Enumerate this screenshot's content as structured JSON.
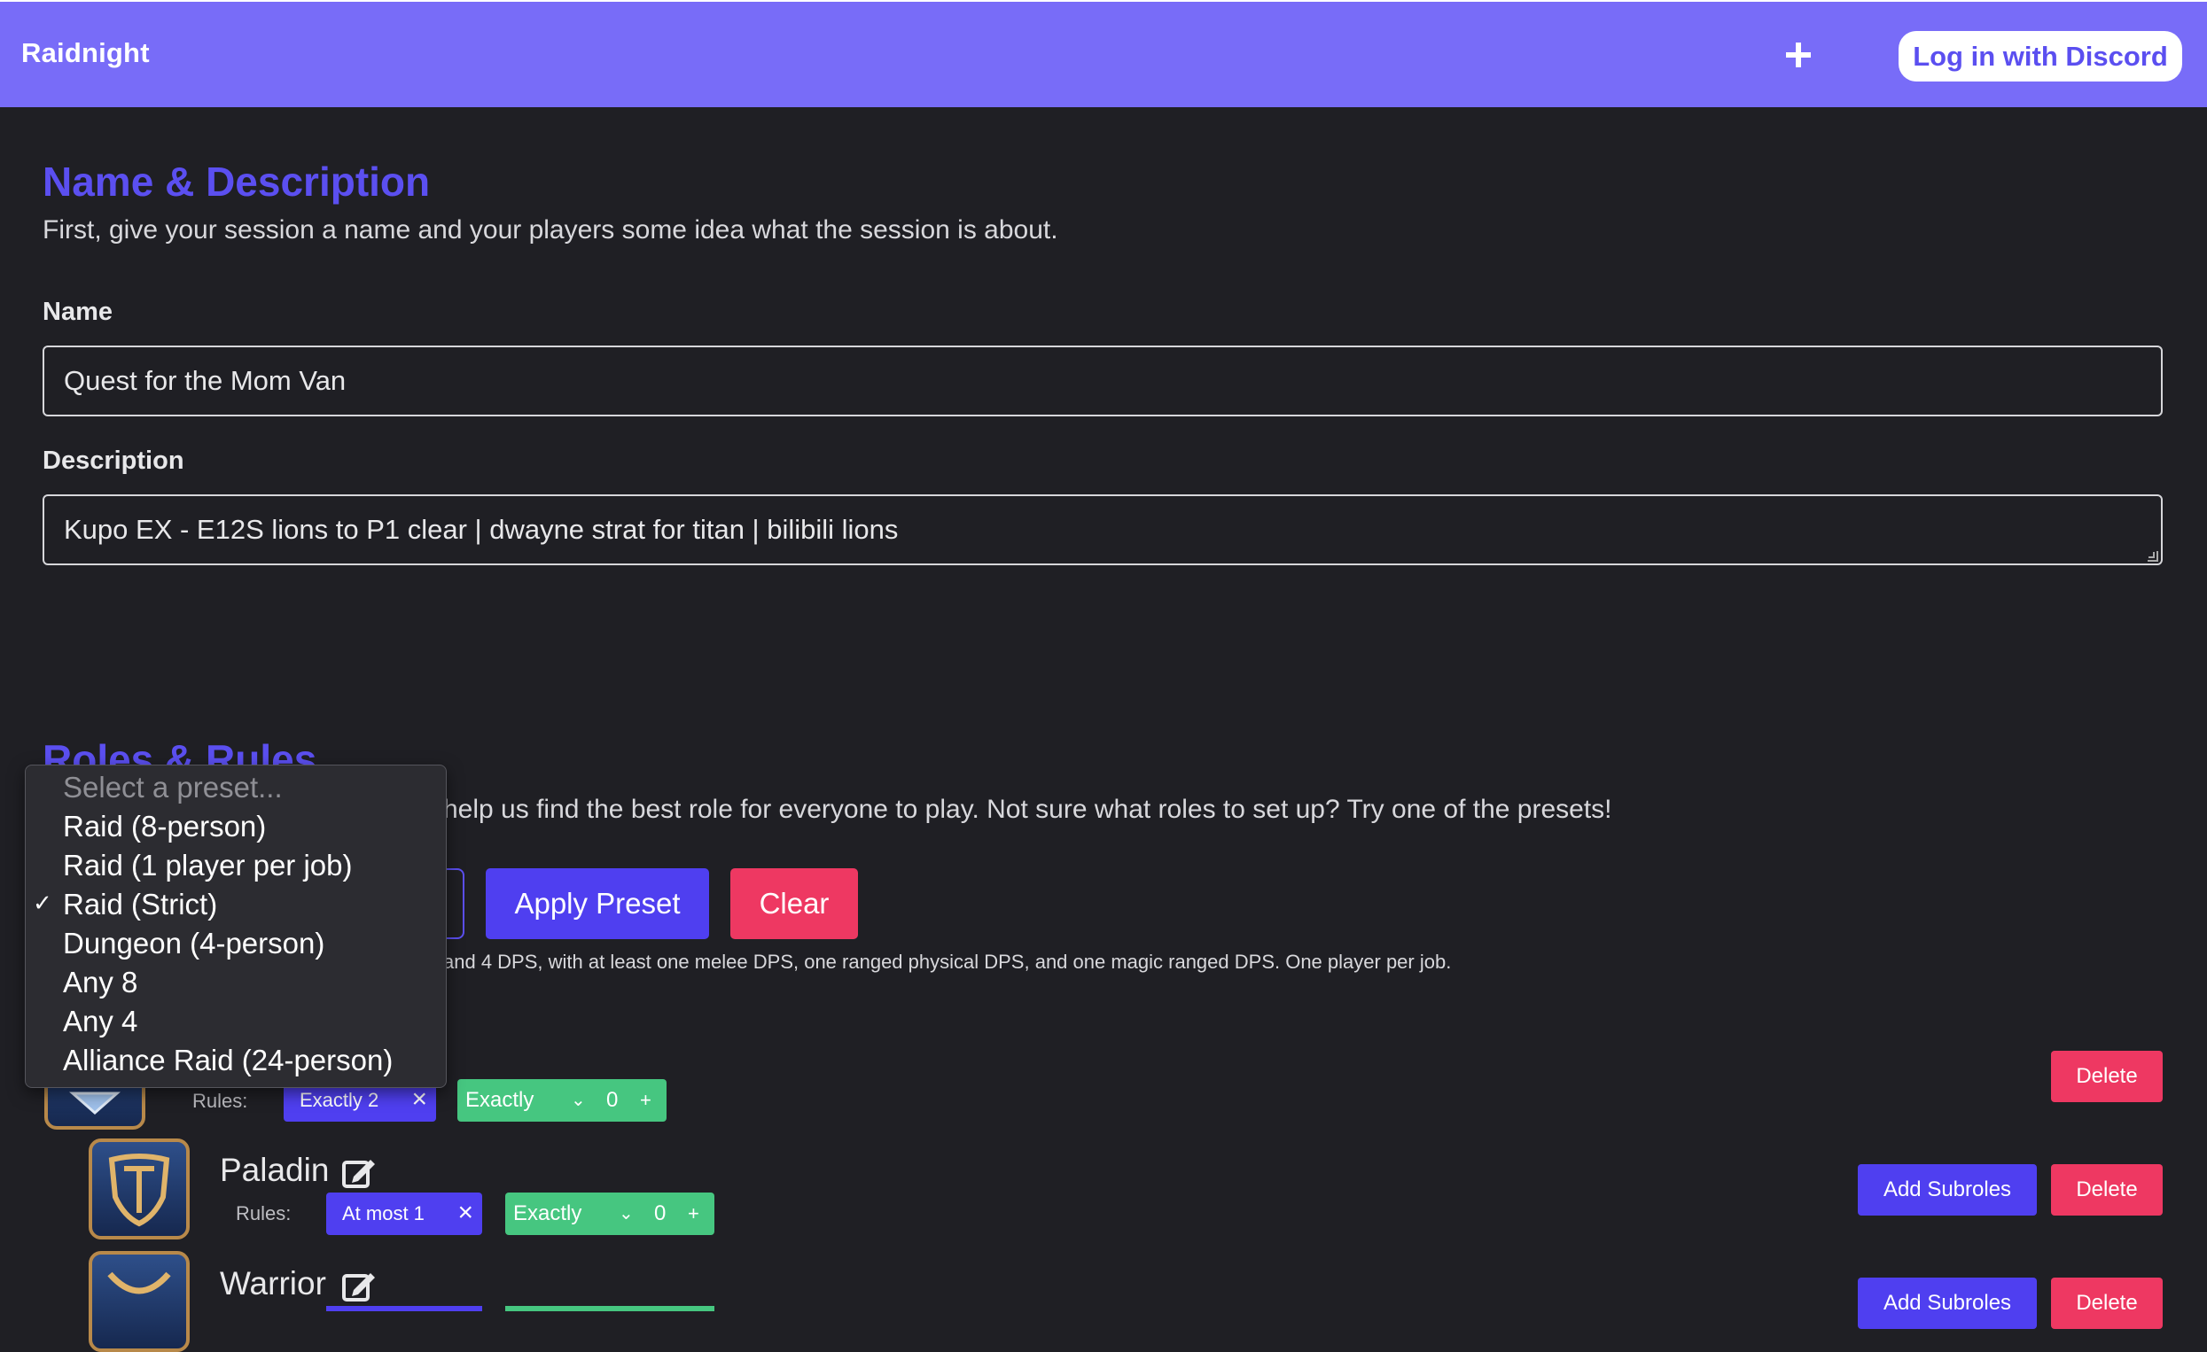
{
  "app": {
    "title": "Raidnight",
    "new_session_icon": "plus-icon",
    "login_label": "Log in with Discord"
  },
  "name_section": {
    "title": "Name & Description",
    "subtitle": "First, give your session a name and your players some idea what the session is about.",
    "name_label": "Name",
    "name_value": "Quest for the Mom Van",
    "description_label": "Description",
    "description_value": "Kupo EX - E12S lions to P1 clear | dwayne strat for titan | bilibili lions"
  },
  "roles_section": {
    "title": "Roles & Rules",
    "subtitle_visible": "help us find the best role for everyone to play. Not sure what roles to set up? Try one of the presets!",
    "apply_preset_label": "Apply Preset",
    "clear_label": "Clear",
    "preset_help_visible": "and 4 DPS, with at least one melee DPS, one ranged physical DPS, and one magic ranged DPS. One player per job."
  },
  "preset_dropdown": {
    "placeholder": "Select a preset...",
    "options": [
      "Raid (8-person)",
      "Raid (1 player per job)",
      "Raid (Strict)",
      "Dungeon (4-person)",
      "Any 8",
      "Any 4",
      "Alliance Raid (24-person)"
    ],
    "selected": "Raid (Strict)",
    "check_glyph": "✓"
  },
  "roles": [
    {
      "name": "",
      "rules_label": "Rules:",
      "rule_tag": "Exactly 2",
      "new_rule_type": "Exactly",
      "new_rule_value": "0",
      "delete_label": "Delete"
    },
    {
      "name": "Paladin",
      "rules_label": "Rules:",
      "rule_tag": "At most 1",
      "new_rule_type": "Exactly",
      "new_rule_value": "0",
      "add_subroles_label": "Add Subroles",
      "delete_label": "Delete"
    },
    {
      "name": "Warrior",
      "add_subroles_label": "Add Subroles",
      "delete_label": "Delete"
    }
  ],
  "colors": {
    "header": "#786cf8",
    "accent": "#4f3ff0",
    "danger": "#ee3862",
    "success": "#46c680",
    "background": "#1f1f24"
  }
}
